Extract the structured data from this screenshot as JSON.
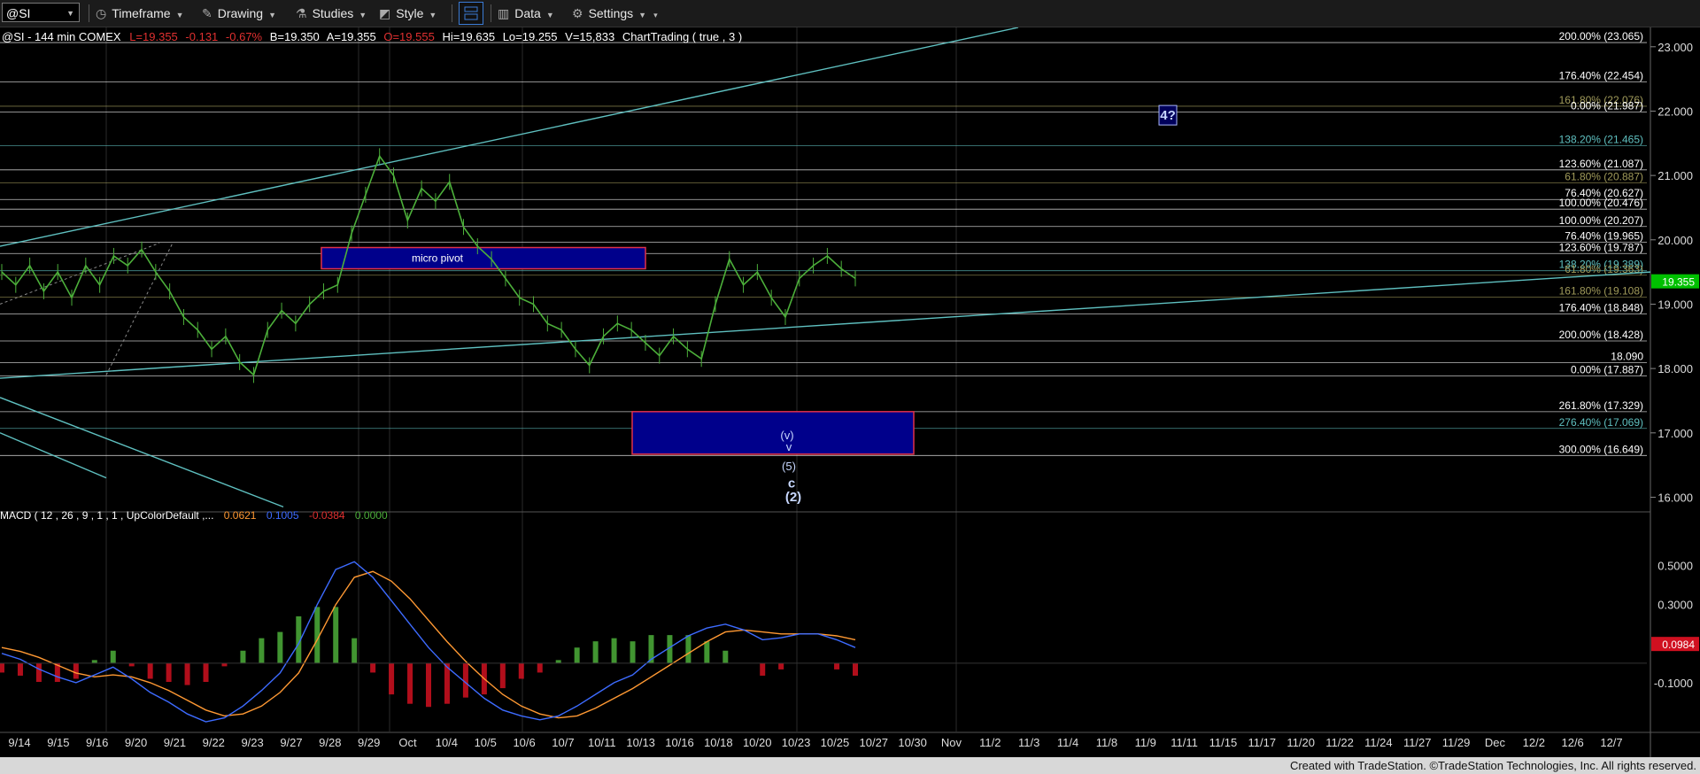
{
  "toolbar": {
    "symbol": "@SI",
    "timeframe": "Timeframe",
    "drawing": "Drawing",
    "studies": "Studies",
    "style": "Style",
    "data": "Data",
    "settings": "Settings"
  },
  "header": {
    "name": "@SI - 144 min  COMEX",
    "last": "L=19.355",
    "change": "-0.131",
    "change_pct": "-0.67%",
    "bid": "B=19.350",
    "ask": "A=19.355",
    "open": "O=19.555",
    "high": "Hi=19.635",
    "low": "Lo=19.255",
    "volume": "V=15,833",
    "study": "ChartTrading ( true , 3 )"
  },
  "macd_header": {
    "label": "MACD ( 12 , 26 , 9 , 1 , 1 , UpColorDefault ,...",
    "v1": "0.0621",
    "v2": "0.1005",
    "v3": "-0.0384",
    "v4": "0.0000"
  },
  "footer": {
    "credit": "Created with TradeStation. ©TradeStation Technologies, Inc. All rights reserved."
  },
  "chart_data": {
    "type": "line",
    "series": [
      {
        "values": [
          19.5,
          19.3,
          19.6,
          19.2,
          19.5,
          19.1,
          19.6,
          19.3,
          19.75,
          19.6,
          19.85,
          19.5,
          19.2,
          18.8,
          18.6,
          18.3,
          18.5,
          18.1,
          17.9,
          18.6,
          18.9,
          18.7,
          19.0,
          19.2,
          19.3,
          20.1,
          20.7,
          21.3,
          21.0,
          20.3,
          20.8,
          20.6,
          20.9,
          20.2,
          19.9,
          19.7,
          19.4,
          19.1,
          19.0,
          18.7,
          18.6,
          18.3,
          18.05,
          18.5,
          18.7,
          18.6,
          18.4,
          18.2,
          18.5,
          18.3,
          18.15,
          19.0,
          19.7,
          19.3,
          19.5,
          19.1,
          18.8,
          19.4,
          19.6,
          19.75,
          19.55,
          19.4
        ]
      }
    ],
    "macd": {
      "macd": [
        0.05,
        0.02,
        -0.03,
        -0.07,
        -0.1,
        -0.06,
        -0.02,
        -0.08,
        -0.15,
        -0.2,
        -0.26,
        -0.3,
        -0.28,
        -0.22,
        -0.14,
        -0.05,
        0.1,
        0.3,
        0.48,
        0.52,
        0.44,
        0.32,
        0.2,
        0.08,
        -0.02,
        -0.1,
        -0.18,
        -0.24,
        -0.27,
        -0.29,
        -0.27,
        -0.22,
        -0.16,
        -0.1,
        -0.06,
        0.02,
        0.08,
        0.14,
        0.18,
        0.2,
        0.17,
        0.12,
        0.13,
        0.15,
        0.15,
        0.12,
        0.08
      ],
      "signal": [
        0.08,
        0.06,
        0.03,
        -0.01,
        -0.05,
        -0.07,
        -0.06,
        -0.07,
        -0.1,
        -0.14,
        -0.19,
        -0.24,
        -0.27,
        -0.26,
        -0.22,
        -0.15,
        -0.05,
        0.12,
        0.3,
        0.44,
        0.47,
        0.42,
        0.33,
        0.22,
        0.11,
        0.01,
        -0.08,
        -0.16,
        -0.22,
        -0.26,
        -0.28,
        -0.27,
        -0.23,
        -0.18,
        -0.13,
        -0.07,
        -0.01,
        0.05,
        0.11,
        0.16,
        0.17,
        0.16,
        0.15,
        0.15,
        0.15,
        0.14,
        0.12
      ]
    },
    "x_labels": [
      "9/14",
      "9/15",
      "9/16",
      "9/20",
      "9/21",
      "9/22",
      "9/23",
      "9/27",
      "9/28",
      "9/29",
      "Oct",
      "10/4",
      "10/5",
      "10/6",
      "10/7",
      "10/11",
      "10/13",
      "10/16",
      "10/18",
      "10/20",
      "10/23",
      "10/25",
      "10/27",
      "10/30",
      "Nov",
      "11/2",
      "11/3",
      "11/4",
      "11/8",
      "11/9",
      "11/11",
      "11/15",
      "11/17",
      "11/20",
      "11/22",
      "11/24",
      "11/27",
      "11/29",
      "Dec",
      "12/2",
      "12/6",
      "12/7"
    ],
    "y_ticks": [
      "23.000",
      "22.000",
      "21.000",
      "20.000",
      "19.000",
      "18.000",
      "17.000",
      "16.000"
    ],
    "ylim": [
      15.8,
      23.3
    ],
    "macd_ticks": [
      "0.5000",
      "0.3000",
      "0.1000",
      "-0.1000"
    ],
    "macd_ylim": [
      -0.35,
      0.68
    ],
    "last_price": "19.355",
    "macd_last": "0.0984",
    "fib_levels": [
      {
        "label": "200.00% (23.065)",
        "value": 23.065,
        "color": "#ffffff"
      },
      {
        "label": "176.40% (22.454)",
        "value": 22.454,
        "color": "#ffffff"
      },
      {
        "label": "161.80% (22.076)",
        "value": 22.076,
        "color": "#a09a5a"
      },
      {
        "label": "0.00% (21.987)",
        "value": 21.987,
        "color": "#ffffff"
      },
      {
        "label": "138.20% (21.465)",
        "value": 21.465,
        "color": "#5fc0c0"
      },
      {
        "label": "123.60% (21.087)",
        "value": 21.087,
        "color": "#ffffff"
      },
      {
        "label": "61.80% (20.887)",
        "value": 20.887,
        "color": "#a09a5a"
      },
      {
        "label": "76.40% (20.627)",
        "value": 20.627,
        "color": "#ffffff"
      },
      {
        "label": "100.00% (20.476)",
        "value": 20.476,
        "color": "#ffffff"
      },
      {
        "label": "100.00% (20.207)",
        "value": 20.207,
        "color": "#ffffff"
      },
      {
        "label": "76.40% (19.965)",
        "value": 19.965,
        "color": "#ffffff"
      },
      {
        "label": "123.60% (19.787)",
        "value": 19.787,
        "color": "#ffffff"
      },
      {
        "label": "138.20% (19.389)",
        "value": 19.52,
        "color": "#5fc0c0"
      },
      {
        "label": "61.80% (19.363)",
        "value": 19.45,
        "color": "#a09a5a"
      },
      {
        "label": "161.80% (19.108)",
        "value": 19.108,
        "color": "#a09a5a"
      },
      {
        "label": "176.40% (18.848)",
        "value": 18.848,
        "color": "#ffffff"
      },
      {
        "label": "200.00% (18.428)",
        "value": 18.428,
        "color": "#ffffff"
      },
      {
        "label": "18.090",
        "value": 18.09,
        "color": "#ffffff"
      },
      {
        "label": "0.00% (17.887)",
        "value": 17.887,
        "color": "#ffffff"
      },
      {
        "label": "261.80% (17.329)",
        "value": 17.329,
        "color": "#ffffff"
      },
      {
        "label": "276.40% (17.069)",
        "value": 17.069,
        "color": "#5fc0c0"
      },
      {
        "label": "300.00% (16.649)",
        "value": 16.649,
        "color": "#ffffff"
      }
    ],
    "annotations": {
      "micro_pivot": "micro pivot",
      "wave_v_lower": "(v)",
      "wave_v_upper": "v",
      "wave_5": "(5)",
      "wave_c": "c",
      "wave_2": "(2)",
      "wave_4": "4?"
    },
    "colors": {
      "price": "#4caf3a",
      "price_marker": "#00c000",
      "trend": "#5fc0c0",
      "target_box": "#00008b",
      "box_border": "#e0304a",
      "macd_line": "#3d6bff",
      "signal_line": "#ff9933",
      "macd_last_marker": "#d01020"
    }
  }
}
